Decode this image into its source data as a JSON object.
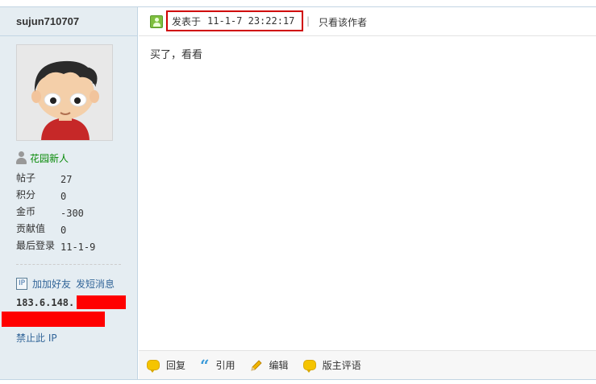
{
  "author": {
    "username": "sujun710707",
    "rank": "花园新人",
    "stats": [
      {
        "label": "帖子",
        "value": "27"
      },
      {
        "label": "积分",
        "value": "0"
      },
      {
        "label": "金币",
        "value": "-300"
      },
      {
        "label": "贡献值",
        "value": "0"
      },
      {
        "label": "最后登录",
        "value": "11-1-9"
      }
    ],
    "ip_icon": "IP",
    "add_friend": "加加好友",
    "send_message": "发短消息",
    "ip_partial": "183.6.148.",
    "ban_ip": "禁止此 IP"
  },
  "post": {
    "posted_label": "发表于",
    "posted_time": "11-1-7 23:22:17",
    "separator": "|",
    "only_author": "只看该作者",
    "body": "买了，看看",
    "footer": {
      "reply": "回复",
      "quote": "引用",
      "edit": "编辑",
      "mod_comment": "版主评语"
    }
  },
  "colors": {
    "sidebar_bg": "#e5edf2",
    "border": "#c2d5e3",
    "rank_green": "#088a08",
    "link_blue": "#336699",
    "highlight_red": "#d00000",
    "redaction": "#ff0000"
  }
}
